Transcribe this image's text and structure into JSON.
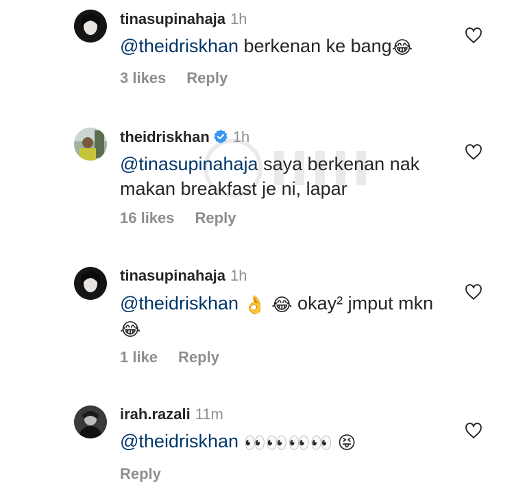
{
  "comments": [
    {
      "username": "tinasupinahaja",
      "time": "1h",
      "verified": false,
      "mention": "@theidriskhan",
      "text": " berkenan ke bang",
      "emoji_end": "😂",
      "likes": "3 likes",
      "reply": "Reply",
      "avatar_icon": "dark-portrait-avatar"
    },
    {
      "username": "theidriskhan",
      "time": "1h",
      "verified": true,
      "mention": "@tinasupinahaja",
      "text": " saya berkenan nak makan breakfast je ni, lapar",
      "likes": "16 likes",
      "reply": "Reply",
      "avatar_icon": "outdoor-portrait-avatar"
    },
    {
      "username": "tinasupinahaja",
      "time": "1h",
      "verified": false,
      "mention": "@theidriskhan",
      "emoji_mid": "👌 😂",
      "text": " okay² jmput mkn",
      "emoji_end": "😂",
      "likes": "1 like",
      "reply": "Reply",
      "avatar_icon": "dark-portrait-avatar"
    },
    {
      "username": "irah.razali",
      "time": "11m",
      "verified": false,
      "mention": "@theidriskhan",
      "emoji_mid": "👀👀👀👀",
      "emoji_end": "😝",
      "reply": "Reply",
      "avatar_icon": "bw-portrait-avatar"
    }
  ],
  "colors": {
    "mention": "#00376b",
    "username": "#262626",
    "secondary": "#8e8e8e",
    "verified": "#3897f0"
  }
}
